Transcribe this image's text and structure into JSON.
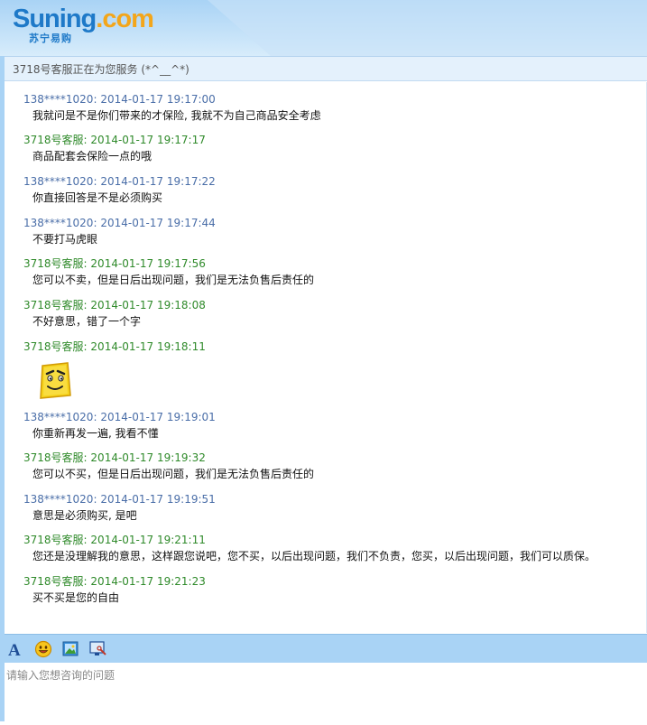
{
  "header": {
    "logo_main": "Suning",
    "logo_dot": ".com",
    "logo_sub": "苏宁易购"
  },
  "status": {
    "text": "3718号客服正在为您服务 (*^__^*)"
  },
  "messages": [
    {
      "role": "customer",
      "sender": "138****1020:",
      "time": "2014-01-17 19:17:00",
      "text": "我就问是不是你们带来的才保险, 我就不为自己商品安全考虑"
    },
    {
      "role": "agent",
      "sender": "3718号客服:",
      "time": "2014-01-17 19:17:17",
      "text": "商品配套会保险一点的哦"
    },
    {
      "role": "customer",
      "sender": "138****1020:",
      "time": "2014-01-17 19:17:22",
      "text": "你直接回答是不是必须购买"
    },
    {
      "role": "customer",
      "sender": "138****1020:",
      "time": "2014-01-17 19:17:44",
      "text": "不要打马虎眼"
    },
    {
      "role": "agent",
      "sender": "3718号客服:",
      "time": "2014-01-17 19:17:56",
      "text": "您可以不卖，但是日后出现问题，我们是无法负售后责任的"
    },
    {
      "role": "agent",
      "sender": "3718号客服:",
      "time": "2014-01-17 19:18:08",
      "text": "不好意思，错了一个字"
    },
    {
      "role": "agent",
      "sender": "3718号客服:",
      "time": "2014-01-17 19:18:11",
      "text": "",
      "emoticon": "smiling-face-emoticon"
    },
    {
      "role": "customer",
      "sender": "138****1020:",
      "time": "2014-01-17 19:19:01",
      "text": "你重新再发一遍, 我看不懂"
    },
    {
      "role": "agent",
      "sender": "3718号客服:",
      "time": "2014-01-17 19:19:32",
      "text": "您可以不买，但是日后出现问题，我们是无法负售后责任的"
    },
    {
      "role": "customer",
      "sender": "138****1020:",
      "time": "2014-01-17 19:19:51",
      "text": "意思是必须购买, 是吧"
    },
    {
      "role": "agent",
      "sender": "3718号客服:",
      "time": "2014-01-17 19:21:11",
      "text": "您还是没理解我的意思，这样跟您说吧，您不买，以后出现问题，我们不负责，您买，以后出现问题，我们可以质保。"
    },
    {
      "role": "agent",
      "sender": "3718号客服:",
      "time": "2014-01-17 19:21:23",
      "text": "买不买是您的自由"
    }
  ],
  "toolbar": {
    "icons": [
      "font-icon",
      "emoji-icon",
      "image-icon",
      "screenshot-icon"
    ]
  },
  "input": {
    "placeholder": "请输入您想咨询的问题",
    "value": ""
  },
  "colors": {
    "customer": "#4a6ea8",
    "agent": "#2f8a2a",
    "accent": "#a9d3f5",
    "logo": "#1e79c8",
    "logo_dot": "#f3a61b"
  }
}
